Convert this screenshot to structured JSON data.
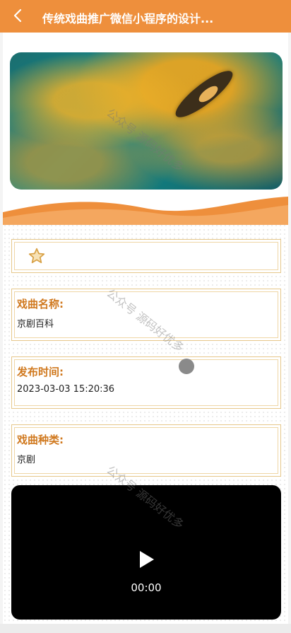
{
  "header": {
    "title": "传统戏曲推广微信小程序的设计...",
    "back_icon": "chevron-left-icon",
    "bg_color": "#ee8f3c"
  },
  "favorite": {
    "icon": "star-outline-icon"
  },
  "fields": [
    {
      "label": "戏曲名称:",
      "value": "京剧百科"
    },
    {
      "label": "发布时间:",
      "value": "2023-03-03 15:20:36"
    },
    {
      "label": "戏曲种类:",
      "value": "京剧"
    }
  ],
  "video": {
    "time": "00:00",
    "play_icon": "play-icon"
  },
  "watermark_text": "公众号 源码好优多"
}
